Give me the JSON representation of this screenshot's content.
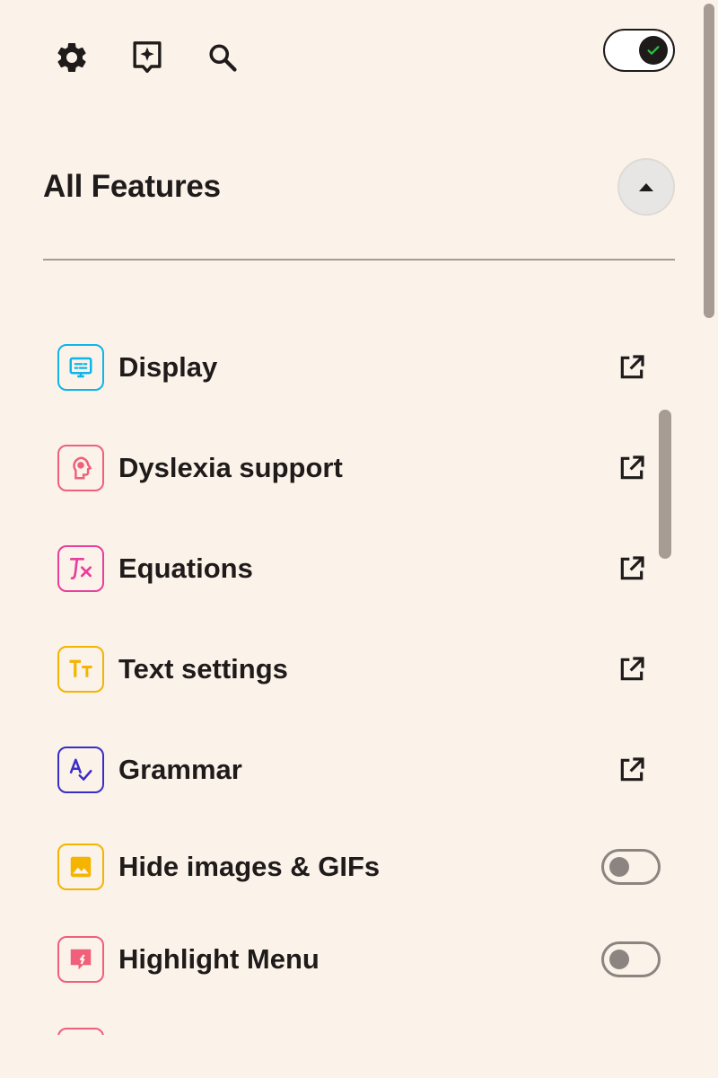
{
  "header": {
    "master_toggle_on": true
  },
  "section": {
    "title": "All Features"
  },
  "features": [
    {
      "label": "Display",
      "icon": "display-settings-icon",
      "color": "#0fb5e8",
      "control": "open"
    },
    {
      "label": "Dyslexia support",
      "icon": "head-brain-icon",
      "color": "#f0607a",
      "control": "open"
    },
    {
      "label": "Equations",
      "icon": "function-icon",
      "color": "#e83e9c",
      "control": "open"
    },
    {
      "label": "Text settings",
      "icon": "text-size-icon",
      "color": "#f4b400",
      "control": "open"
    },
    {
      "label": "Grammar",
      "icon": "spellcheck-icon",
      "color": "#3a2ec8",
      "control": "open"
    },
    {
      "label": "Hide images & GIFs",
      "icon": "image-icon",
      "color": "#f4b400",
      "control": "toggle",
      "enabled": false
    },
    {
      "label": "Highlight Menu",
      "icon": "highlight-comment-icon",
      "color": "#f0607a",
      "control": "toggle",
      "enabled": false
    }
  ],
  "colors": {
    "background": "#fbf2ea",
    "text": "#1f1b1a",
    "scrollbar": "#a69c94",
    "toggle_check": "#25c23a"
  }
}
